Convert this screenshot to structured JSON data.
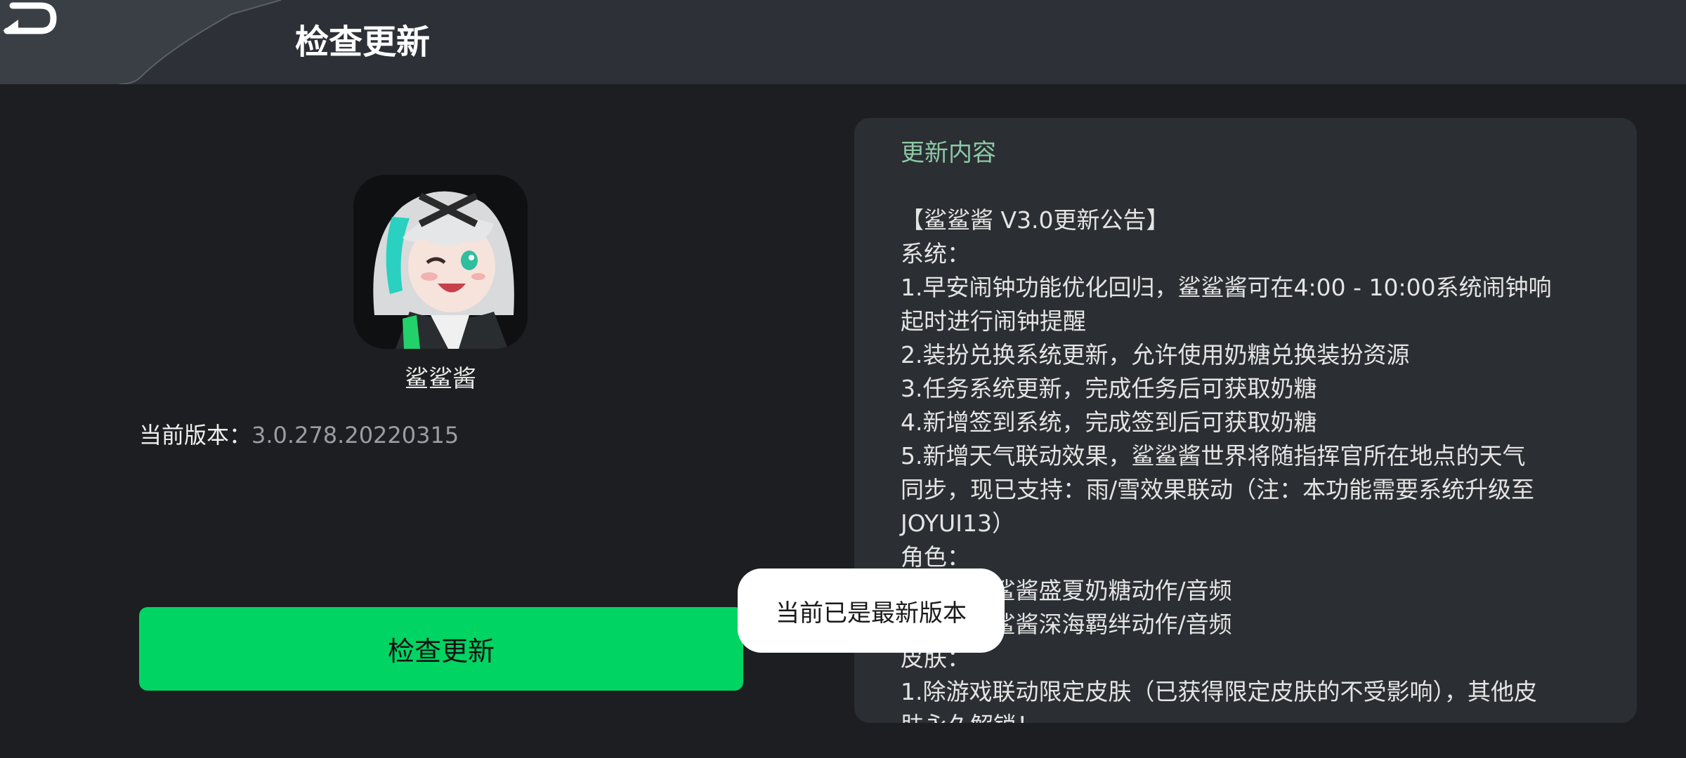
{
  "header": {
    "title": "检查更新",
    "back_icon": "back-arrow-icon"
  },
  "app": {
    "name": "鲨鲨酱",
    "icon": "app-avatar-icon",
    "version_label": "当前版本：",
    "version_value": "3.0.278.20220315"
  },
  "actions": {
    "check_update_label": "检查更新"
  },
  "notes": {
    "heading": "更新内容",
    "lines": [
      "【鲨鲨酱 V3.0更新公告】",
      "系统：",
      "1.早安闹钟功能优化回归，鲨鲨酱可在4:00 - 10:00系统闹钟响",
      "起时进行闹钟提醒",
      "2.装扮兑换系统更新，允许使用奶糖兑换装扮资源",
      "3.任务系统更新，完成任务后可获取奶糖",
      "4.新增签到系统，完成签到后可获取奶糖",
      "5.新增天气联动效果，鲨鲨酱世界将随指挥官所在地点的天气",
      "同步，现已支持：雨/雪效果联动（注：本功能需要系统升级至",
      "JOYUI13）",
      "角色：",
      "1.新增鲨鲨酱盛夏奶糖动作/音频",
      "2.新增鲨鲨酱深海羁绊动作/音频",
      "皮肤：",
      "1.除游戏联动限定皮肤（已获得限定皮肤的不受影响），其他皮",
      "肤永久解锁！"
    ]
  },
  "toast": {
    "message": "当前已是最新版本"
  },
  "colors": {
    "background": "#1c1e21",
    "header": "#2d3137",
    "panel": "#2b2e32",
    "accent_green": "#00d463",
    "notes_heading": "#8cc9a6"
  }
}
